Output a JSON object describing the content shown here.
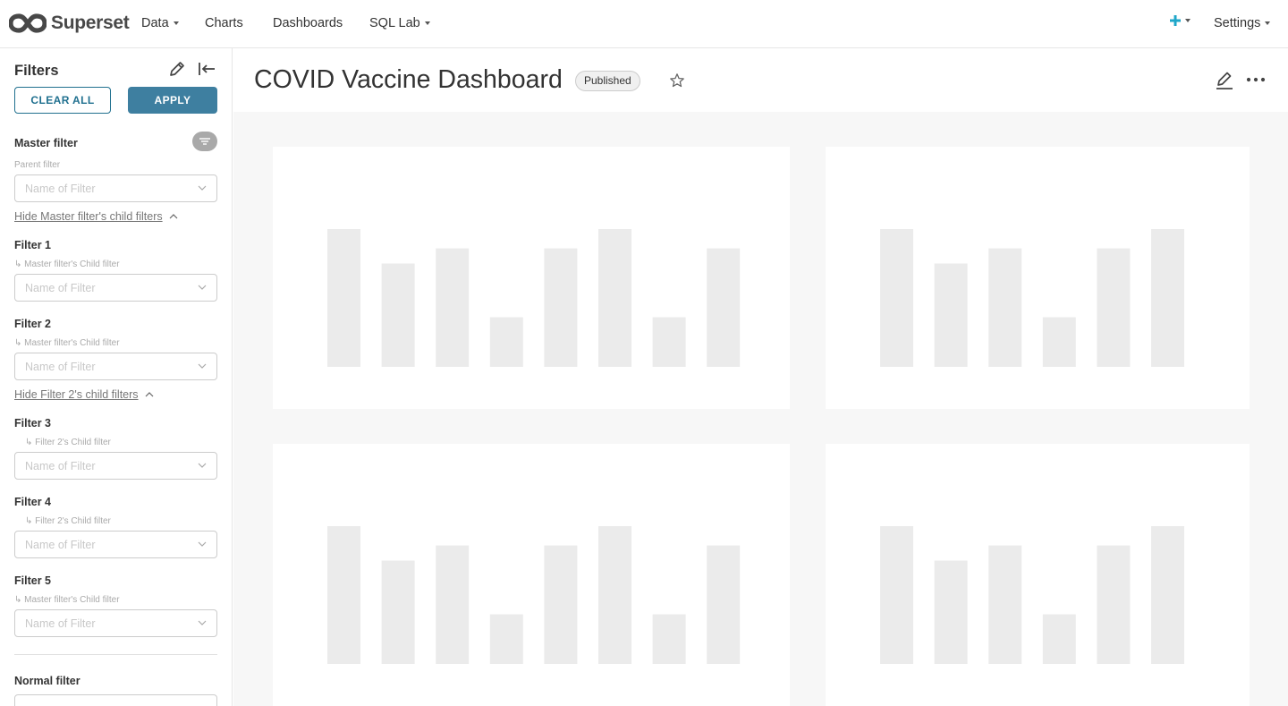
{
  "app": {
    "name": "Superset"
  },
  "nav": {
    "items": [
      {
        "label": "Data",
        "dropdown": true
      },
      {
        "label": "Charts",
        "dropdown": false
      },
      {
        "label": "Dashboards",
        "dropdown": false
      },
      {
        "label": "SQL Lab",
        "dropdown": true
      }
    ],
    "plus_icon": "plus-icon",
    "settings_label": "Settings"
  },
  "sidebar": {
    "title": "Filters",
    "clear_all": "CLEAR ALL",
    "apply": "APPLY",
    "placeholder": "Name of Filter",
    "master": {
      "label": "Master filter",
      "sub": "Parent filter"
    },
    "hide_master_link": "Hide Master filter's child filters",
    "filters": [
      {
        "label": "Filter 1",
        "sub": "↳ Master filter's Child filter"
      },
      {
        "label": "Filter 2",
        "sub": "↳ Master filter's Child filter"
      },
      {
        "label": "Filter 3",
        "sub": "↳ Filter 2's Child filter"
      },
      {
        "label": "Filter 4",
        "sub": "↳ Filter 2's Child filter"
      },
      {
        "label": "Filter 5",
        "sub": "↳ Master filter's Child filter"
      }
    ],
    "hide_filter2_link": "Hide Filter 2's child filters",
    "normal": {
      "label": "Normal filter"
    }
  },
  "dashboard": {
    "title": "COVID Vaccine Dashboard",
    "status_badge": "Published",
    "skeleton_color": "#ebebeb",
    "cards": [
      {
        "bars": [
          1.0,
          0.75,
          0.86,
          0.36,
          0.86,
          1.0,
          0.36,
          0.86
        ]
      },
      {
        "bars": [
          1.0,
          0.75,
          0.86,
          0.36,
          0.86,
          1.0
        ]
      },
      {
        "bars": [
          1.0,
          0.75,
          0.86,
          0.36,
          0.86,
          1.0,
          0.36,
          0.86
        ]
      },
      {
        "bars": [
          1.0,
          0.75,
          0.86,
          0.36,
          0.86,
          1.0
        ]
      }
    ]
  },
  "colors": {
    "accent": "#20708f",
    "apply_bg": "#3e7fa0",
    "plus": "#20a7c9"
  }
}
